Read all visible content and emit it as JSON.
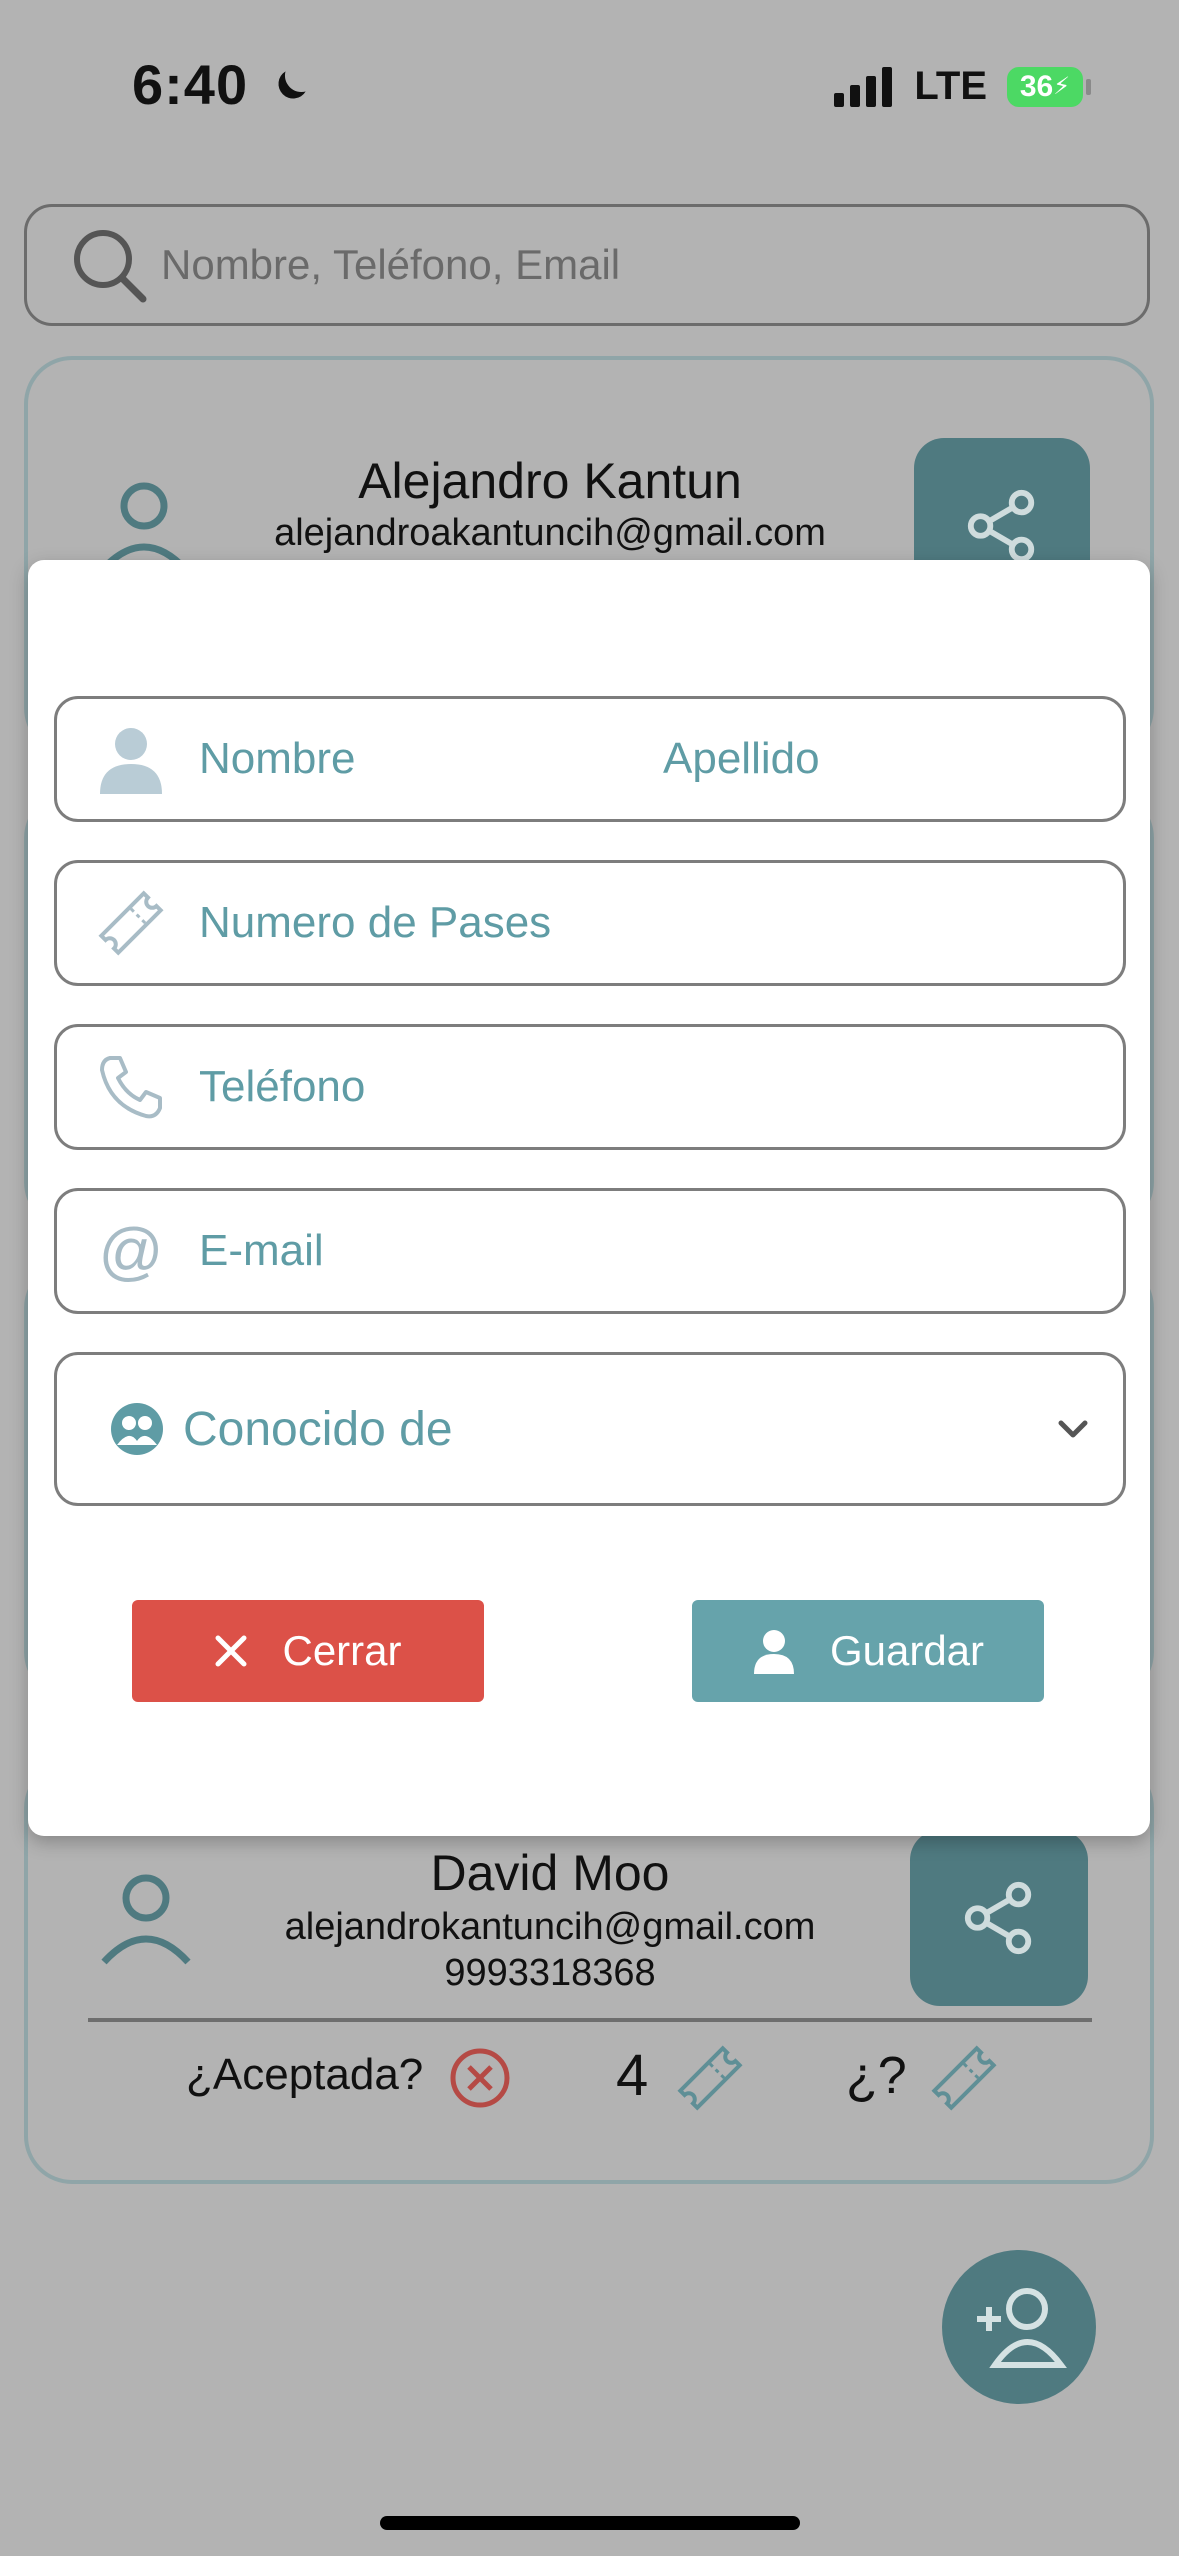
{
  "status_bar": {
    "time": "6:40",
    "network": "LTE",
    "battery": "36"
  },
  "search": {
    "placeholder": "Nombre, Teléfono, Email"
  },
  "contacts": [
    {
      "name": "Alejandro Kantun",
      "email": "alejandroakantuncih@gmail.com"
    },
    {
      "name": "David Moo",
      "email": "alejandrokantuncih@gmail.com",
      "phone": "9993318368",
      "accepted_label": "¿Aceptada?",
      "passes": "4",
      "unknown_passes": "¿?"
    }
  ],
  "modal": {
    "first_name_placeholder": "Nombre",
    "last_name_placeholder": "Apellido",
    "passes_placeholder": "Numero de Pases",
    "phone_placeholder": "Teléfono",
    "email_placeholder": "E-mail",
    "known_from_placeholder": "Conocido de",
    "close_label": "Cerrar",
    "save_label": "Guardar"
  },
  "colors": {
    "teal_dark": "#4f7a80",
    "teal_light": "#66a3ab",
    "red": "#dc5148",
    "placeholder_text": "#5f9ca5"
  }
}
